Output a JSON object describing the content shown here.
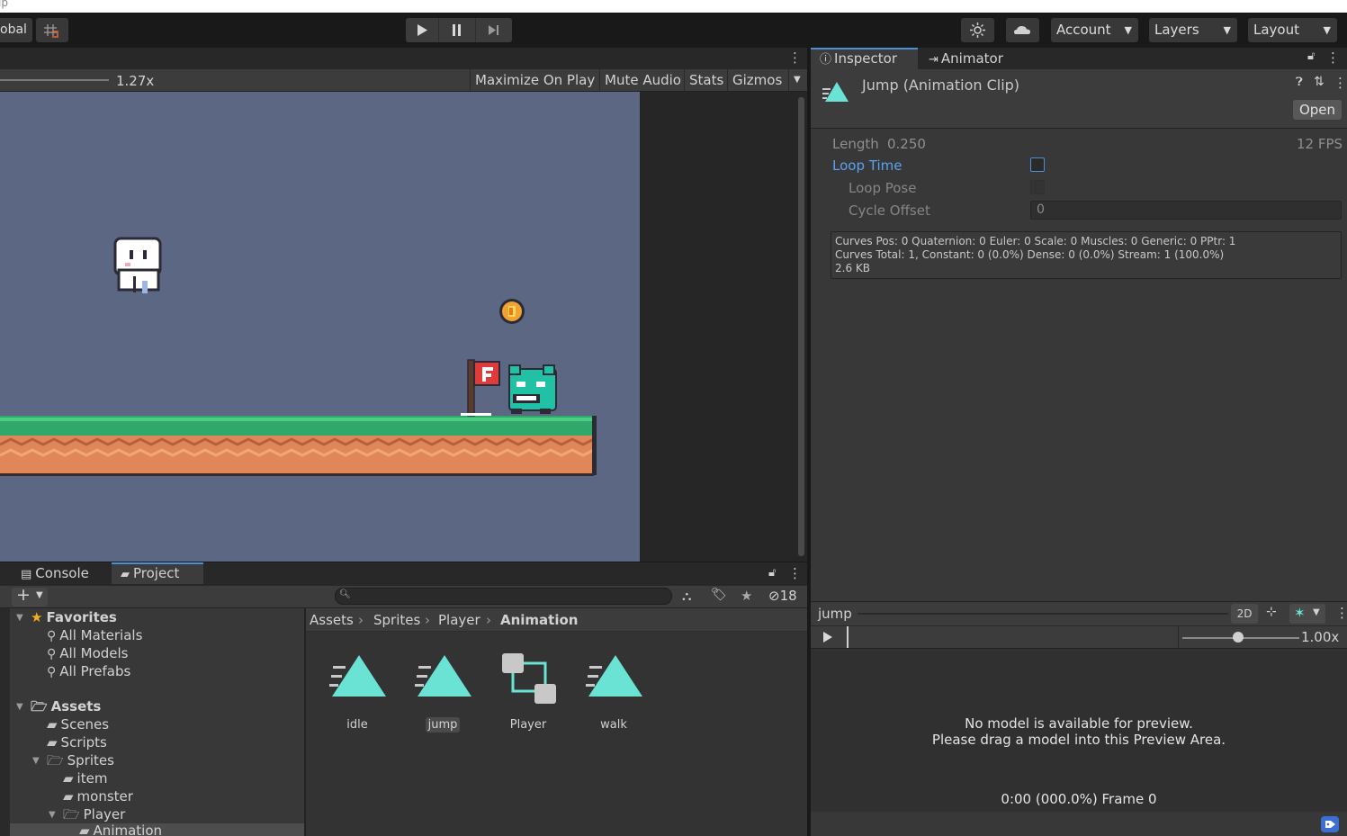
{
  "top_strip": {
    "text": "ip"
  },
  "toolbar": {
    "global_label": "obal",
    "account_label": "Account",
    "layers_label": "Layers",
    "layout_label": "Layout"
  },
  "game_view": {
    "zoom": "1.27x",
    "maximize_on_play": "Maximize On Play",
    "mute_audio": "Mute Audio",
    "stats": "Stats",
    "gizmos": "Gizmos"
  },
  "inspector": {
    "tabs": [
      "Inspector",
      "Animator"
    ],
    "clip_title": "Jump (Animation Clip)",
    "open_label": "Open",
    "length_label": "Length",
    "length_value": "0.250",
    "fps": "12 FPS",
    "loop_time_label": "Loop Time",
    "loop_pose_label": "Loop Pose",
    "cycle_offset_label": "Cycle Offset",
    "cycle_offset_value": "0",
    "curves_line1": "Curves Pos: 0 Quaternion: 0 Euler: 0 Scale: 0 Muscles: 0 Generic: 0 PPtr: 1",
    "curves_line2": "Curves Total: 1, Constant: 0 (0.0%) Dense: 0 (0.0%) Stream: 1 (100.0%)",
    "curves_line3": "2.6 KB"
  },
  "preview": {
    "name": "jump",
    "mode_2d": "2D",
    "speed": "1.00x",
    "message_line1": "No model is available for preview.",
    "message_line2": "Please drag a model into this Preview Area.",
    "frame_status": "0:00 (000.0%) Frame 0"
  },
  "project": {
    "tabs": [
      "Console",
      "Project"
    ],
    "hidden_count": "18",
    "favorites": {
      "label": "Favorites",
      "items": [
        "All Materials",
        "All Models",
        "All Prefabs"
      ]
    },
    "assets_label": "Assets",
    "tree": [
      "Scenes",
      "Scripts",
      "Sprites",
      "item",
      "monster",
      "Player",
      "Animation"
    ],
    "breadcrumb": [
      "Assets",
      "Sprites",
      "Player",
      "Animation"
    ],
    "files": [
      "idle",
      "jump",
      "Player",
      "walk"
    ]
  },
  "colors": {
    "accent": "#4a90d9",
    "clip_icon": "#6be3d4",
    "game_bg": "#5b6783",
    "grass": "#2fa86a",
    "dirt": "#e0875a"
  }
}
